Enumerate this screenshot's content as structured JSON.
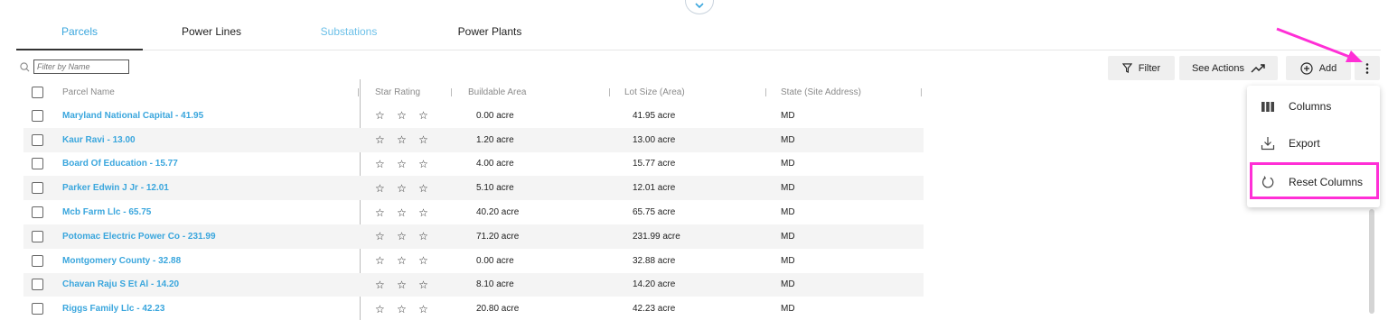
{
  "tabs": [
    "Parcels",
    "Power Lines",
    "Substations",
    "Power Plants"
  ],
  "filter": {
    "placeholder": "Filter by Name"
  },
  "toolbar": {
    "filter_label": "Filter",
    "actions_label": "See Actions",
    "add_label": "Add"
  },
  "columns": [
    "Parcel Name",
    "Star Rating",
    "Buildable Area",
    "Lot Size (Area)",
    "State (Site Address)"
  ],
  "rows": [
    {
      "name": "Maryland National Capital - 41.95",
      "rating": "☆ ☆ ☆",
      "buildable": "0.00 acre",
      "lot": "41.95 acre",
      "state": "MD"
    },
    {
      "name": "Kaur Ravi - 13.00",
      "rating": "☆ ☆ ☆",
      "buildable": "1.20 acre",
      "lot": "13.00 acre",
      "state": "MD"
    },
    {
      "name": "Board Of Education - 15.77",
      "rating": "☆ ☆ ☆",
      "buildable": "4.00 acre",
      "lot": "15.77 acre",
      "state": "MD"
    },
    {
      "name": "Parker Edwin J Jr - 12.01",
      "rating": "☆ ☆ ☆",
      "buildable": "5.10 acre",
      "lot": "12.01 acre",
      "state": "MD"
    },
    {
      "name": "Mcb Farm Llc - 65.75",
      "rating": "☆ ☆ ☆",
      "buildable": "40.20 acre",
      "lot": "65.75 acre",
      "state": "MD"
    },
    {
      "name": "Potomac Electric Power Co - 231.99",
      "rating": "☆ ☆ ☆",
      "buildable": "71.20 acre",
      "lot": "231.99 acre",
      "state": "MD"
    },
    {
      "name": "Montgomery County - 32.88",
      "rating": "☆ ☆ ☆",
      "buildable": "0.00 acre",
      "lot": "32.88 acre",
      "state": "MD"
    },
    {
      "name": "Chavan Raju S Et Al - 14.20",
      "rating": "☆ ☆ ☆",
      "buildable": "8.10 acre",
      "lot": "14.20 acre",
      "state": "MD"
    },
    {
      "name": "Riggs Family Llc - 42.23",
      "rating": "☆ ☆ ☆",
      "buildable": "20.80 acre",
      "lot": "42.23 acre",
      "state": "MD"
    }
  ],
  "menu": [
    "Columns",
    "Export",
    "Reset Columns"
  ],
  "colors": {
    "accent": "#3aa6dd",
    "highlight": "#ff2fd6"
  }
}
